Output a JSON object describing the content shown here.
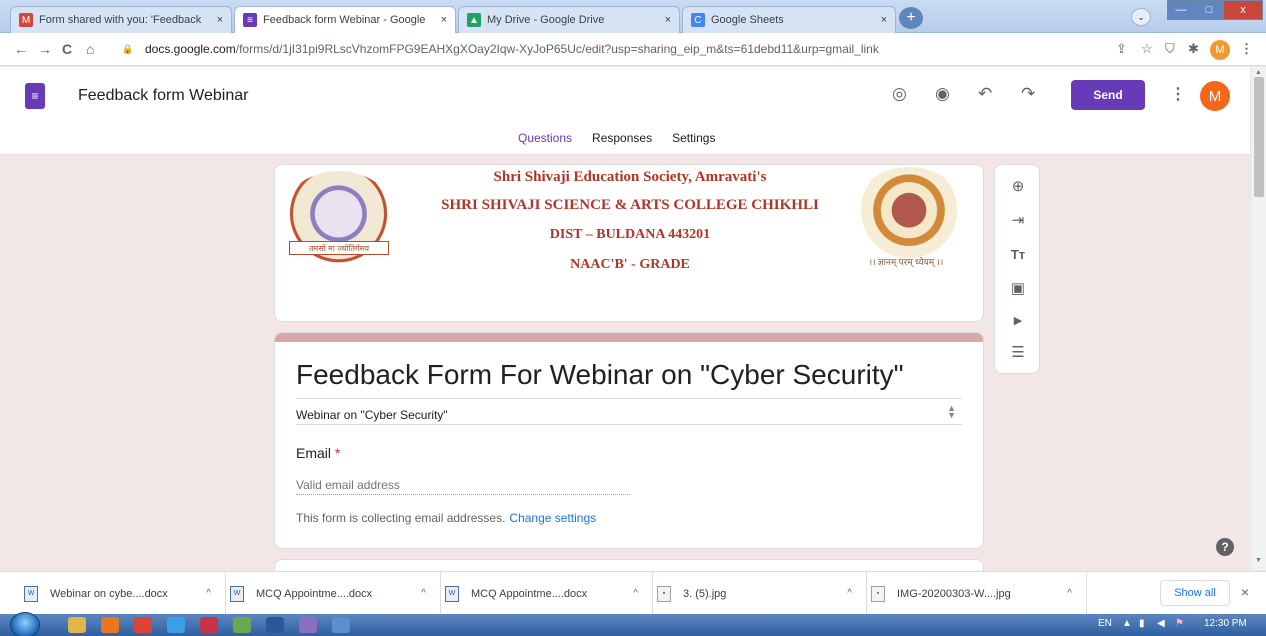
{
  "browser": {
    "tabs": [
      {
        "label": "Form shared with you: 'Feedback",
        "icon": "gmail-icon",
        "color": "#d44638",
        "glyph": "M",
        "active": false
      },
      {
        "label": "Feedback form Webinar - Google",
        "icon": "forms-icon",
        "color": "#673ab7",
        "glyph": "≡",
        "active": true
      },
      {
        "label": "My Drive - Google Drive",
        "icon": "drive-icon",
        "color": "#1fa463",
        "glyph": "▲",
        "active": false
      },
      {
        "label": "Google Sheets",
        "icon": "loading-icon",
        "color": "#4285f4",
        "glyph": "C",
        "active": false
      }
    ],
    "tab_close": "×",
    "new_tab": "+",
    "window_controls": {
      "minimize": "—",
      "maximize": "□",
      "close": "x"
    },
    "url_domain": "docs.google.com",
    "url_path": "/forms/d/1jI31pi9RLscVhzomFPG9EAHXgXOay2Iqw-XyJoP65Uc/edit?usp=sharing_eip_m&ts=61debd11&urp=gmail_link",
    "profile_initial": "M",
    "nav": {
      "back": "←",
      "forward": "→",
      "reload": "C",
      "home": "⌂",
      "lock": "🔒",
      "share": "⇪",
      "star": "☆",
      "ext": "⛉",
      "puzzle": "✱",
      "menu": "⋮"
    }
  },
  "form_header": {
    "title": "Feedback form Webinar",
    "send_label": "Send",
    "avatar_initial": "M",
    "tabs": [
      "Questions",
      "Responses",
      "Settings"
    ],
    "active_tab": "Questions",
    "icons": {
      "palette": "◎",
      "preview": "◉",
      "undo": "↶",
      "redo": "↷",
      "more": "⋮"
    }
  },
  "header_image": {
    "line1": "Shri Shivaji Education Society, Amravati's",
    "line2": "SHRI SHIVAJI SCIENCE & ARTS COLLEGE CHIKHLI",
    "line3": "DIST – BULDANA 443201",
    "line4": "NAAC'B' - GRADE",
    "left_motto": "तमसो मा ज्योतिर्गमय",
    "right_motto": "।। ज्ञानम् परम् ध्येयम् ।।"
  },
  "side_toolbar": {
    "icons": [
      {
        "name": "add-question-icon",
        "glyph": "⊕"
      },
      {
        "name": "import-questions-icon",
        "glyph": "⇥"
      },
      {
        "name": "add-title-icon",
        "glyph": "Tт"
      },
      {
        "name": "add-image-icon",
        "glyph": "▣"
      },
      {
        "name": "add-video-icon",
        "glyph": "▶"
      },
      {
        "name": "add-section-icon",
        "glyph": "☰"
      }
    ]
  },
  "form": {
    "title": "Feedback Form For Webinar on \"Cyber Security\"",
    "description": "Webinar on \"Cyber Security\"",
    "email_label": "Email",
    "required_mark": "*",
    "email_placeholder": "Valid email address",
    "collect_note": "This form is collecting email addresses.",
    "change_settings": "Change settings"
  },
  "downloads": {
    "items": [
      {
        "name": "Webinar on cybe....docx",
        "type": "doc"
      },
      {
        "name": "MCQ Appointme....docx",
        "type": "doc"
      },
      {
        "name": "MCQ Appointme....docx",
        "type": "doc"
      },
      {
        "name": "3. (5).jpg",
        "type": "img"
      },
      {
        "name": "IMG-20200303-W....jpg",
        "type": "img"
      }
    ],
    "show_all": "Show all",
    "chevron": "^",
    "close": "×"
  },
  "taskbar": {
    "language": "EN",
    "time": "12:30 PM",
    "apps": [
      {
        "name": "explorer-icon",
        "color": "#e0b64a"
      },
      {
        "name": "media-icon",
        "color": "#e87722"
      },
      {
        "name": "chrome-icon",
        "color": "#db4437"
      },
      {
        "name": "ie-icon",
        "color": "#3aa0e6"
      },
      {
        "name": "app-icon",
        "color": "#c8334a"
      },
      {
        "name": "paint-icon",
        "color": "#6aa84f"
      },
      {
        "name": "word-icon",
        "color": "#2b579a"
      },
      {
        "name": "tool-icon",
        "color": "#8a6fbf"
      },
      {
        "name": "app2-icon",
        "color": "#5a8fd0"
      }
    ]
  }
}
